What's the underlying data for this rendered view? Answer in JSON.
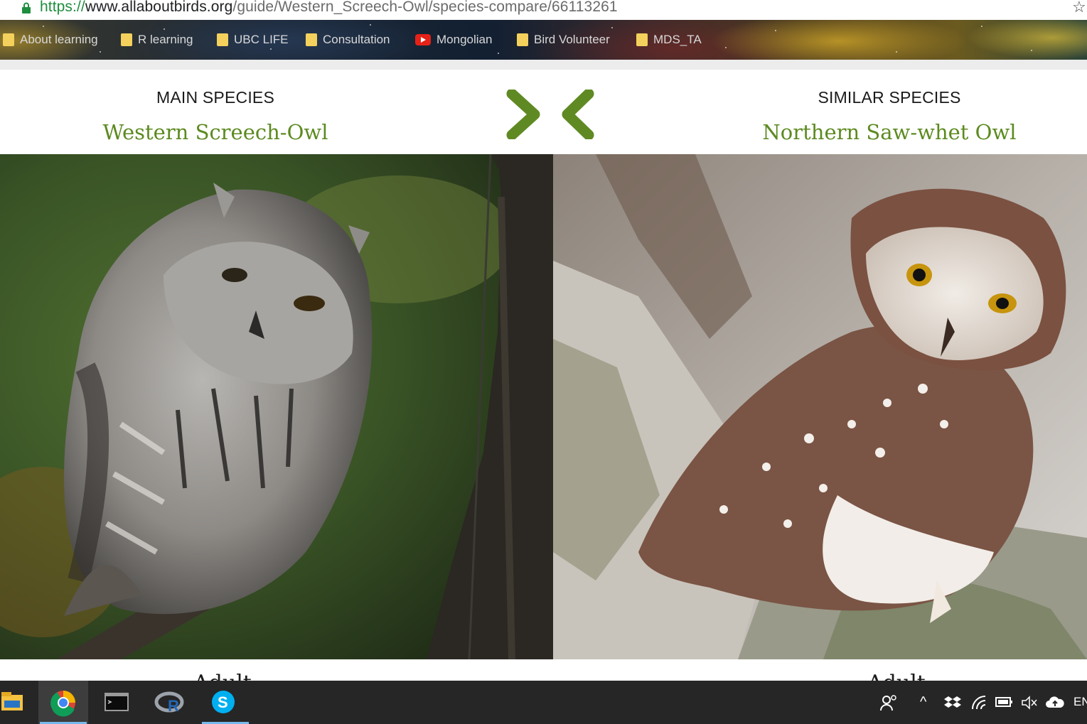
{
  "browser": {
    "url_scheme": "https://",
    "url_host": "www.allaboutbirds.org",
    "url_path": "/guide/Western_Screech-Owl/species-compare/66113261",
    "bookmarks": [
      {
        "label": "About learning",
        "icon": "folder-icon"
      },
      {
        "label": "R learning",
        "icon": "folder-icon"
      },
      {
        "label": "UBC LIFE",
        "icon": "folder-icon"
      },
      {
        "label": "Consultation",
        "icon": "folder-icon"
      },
      {
        "label": "Mongolian",
        "icon": "youtube-icon"
      },
      {
        "label": "Bird Volunteer",
        "icon": "folder-icon"
      },
      {
        "label": "MDS_TA",
        "icon": "folder-icon"
      }
    ]
  },
  "compare": {
    "main_kicker": "MAIN SPECIES",
    "main_name": "Western Screech-Owl",
    "similar_kicker": "SIMILAR SPECIES",
    "similar_name": "Northern Saw-whet Owl",
    "left_caption_peek": "Adult",
    "right_caption_peek": "Adult"
  },
  "colors": {
    "species_name_green": "#5c8a20",
    "chevron_green": "#5f8a23"
  },
  "taskbar": {
    "apps": [
      "file-explorer-icon",
      "chrome-icon",
      "terminal-icon",
      "r-icon",
      "skype-icon"
    ],
    "tray_language": "EN"
  }
}
